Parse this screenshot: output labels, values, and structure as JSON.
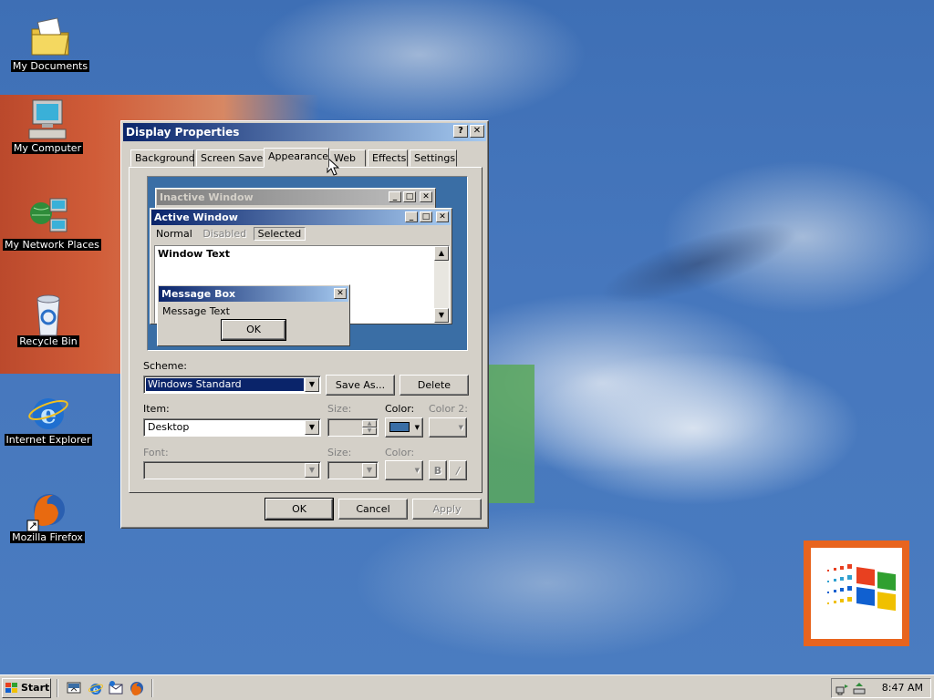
{
  "desktop": {
    "icons": [
      {
        "label": "My Documents",
        "icon": "folder-documents-icon"
      },
      {
        "label": "My Computer",
        "icon": "computer-icon"
      },
      {
        "label": "My Network Places",
        "icon": "network-places-icon"
      },
      {
        "label": "Recycle Bin",
        "icon": "recycle-bin-icon"
      },
      {
        "label": "Internet Explorer",
        "icon": "internet-explorer-icon"
      },
      {
        "label": "Mozilla Firefox",
        "icon": "firefox-icon"
      }
    ]
  },
  "dialog": {
    "title": "Display Properties",
    "help_btn": "?",
    "close_btn": "✕",
    "tabs": [
      "Background",
      "Screen Saver",
      "Appearance",
      "Web",
      "Effects",
      "Settings"
    ],
    "active_tab": "Appearance",
    "preview": {
      "inactive_title": "Inactive Window",
      "active_title": "Active Window",
      "menu": [
        "Normal",
        "Disabled",
        "Selected"
      ],
      "window_text": "Window Text",
      "msgbox_title": "Message Box",
      "msgbox_text": "Message Text",
      "msgbox_ok": "OK"
    },
    "scheme_label": "Scheme:",
    "scheme_value": "Windows Standard",
    "save_as": "Save As...",
    "delete": "Delete",
    "item_label": "Item:",
    "item_value": "Desktop",
    "size_label": "Size:",
    "color_label": "Color:",
    "color2_label": "Color 2:",
    "font_label": "Font:",
    "font_size_label": "Size:",
    "font_color_label": "Color:",
    "bold": "B",
    "italic": "/",
    "ok": "OK",
    "cancel": "Cancel",
    "apply": "Apply",
    "colors": {
      "desktop_color": "#3a6ea5",
      "active_title": "#0a246a",
      "inactive_title": "#808080"
    }
  },
  "taskbar": {
    "start": "Start",
    "clock": "8:47 AM"
  }
}
